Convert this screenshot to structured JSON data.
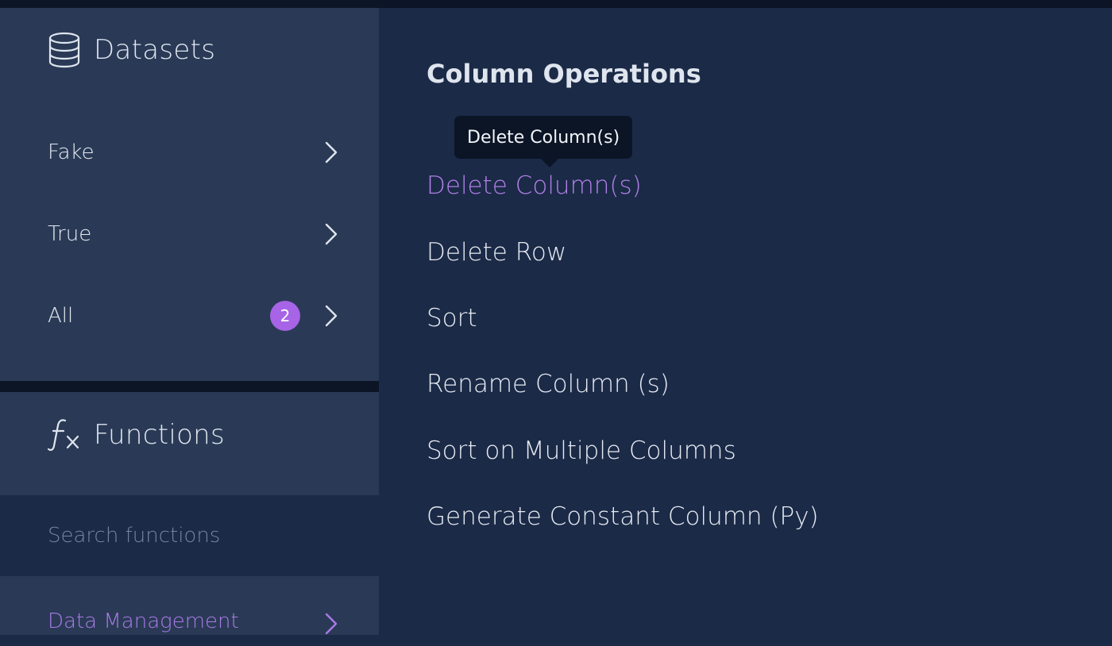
{
  "sidebar": {
    "datasets": {
      "title": "Datasets",
      "icon": "database-icon",
      "items": [
        {
          "label": "Fake"
        },
        {
          "label": "True"
        },
        {
          "label": "All",
          "badge": "2"
        }
      ]
    },
    "functions": {
      "title": "Functions",
      "icon": "function-fx-icon",
      "search_placeholder": "Search functions",
      "search_value": "",
      "categories": [
        {
          "label": "Data Management"
        }
      ]
    }
  },
  "main": {
    "title": "Column Operations",
    "operations": [
      {
        "label": "Delete Column(s)"
      },
      {
        "label": "Delete Row"
      },
      {
        "label": "Sort"
      },
      {
        "label": "Rename Column (s)"
      },
      {
        "label": "Sort on Multiple Columns"
      },
      {
        "label": "Generate Constant Column (Py)"
      }
    ],
    "tooltip": "Delete Column(s)"
  },
  "colors": {
    "background": "#1b2a47",
    "sidebar": "#2a3a56",
    "accent": "#a764e6",
    "active_text": "#b27fe8",
    "tooltip_bg": "#0c1526"
  }
}
